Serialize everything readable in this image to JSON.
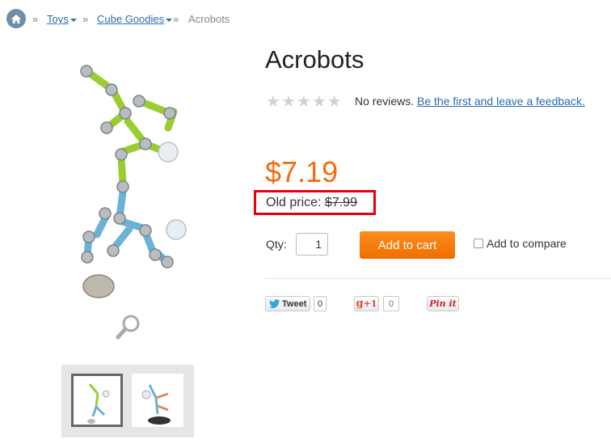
{
  "breadcrumb": {
    "items": [
      {
        "label": "Toys",
        "has_dropdown": true
      },
      {
        "label": "Cube Goodies",
        "has_dropdown": true
      },
      {
        "label": "Acrobots",
        "has_dropdown": false
      }
    ],
    "separator": "»"
  },
  "product": {
    "title": "Acrobots",
    "rating": {
      "stars_filled": 0,
      "stars_total": 5
    },
    "reviews_text": "No reviews.",
    "feedback_link": "Be the first and leave a feedback.",
    "price": "$7.19",
    "old_price_label": "Old price:",
    "old_price_value": "$7.99",
    "qty_label": "Qty:",
    "qty_value": "1",
    "add_to_cart_label": "Add to cart",
    "compare_label": "Add to compare"
  },
  "social": {
    "tweet_label": "Tweet",
    "tweet_count": "0",
    "gplus_label": "+1",
    "gplus_count": "0",
    "pinit_label": "Pin it"
  },
  "colors": {
    "price": "#f26b10",
    "link": "#2a6eab",
    "highlight_box": "#e8000b",
    "cart_button": "#f07a00"
  },
  "icons": [
    "home-icon",
    "zoom-icon",
    "star-icon",
    "twitter-bird-icon"
  ]
}
